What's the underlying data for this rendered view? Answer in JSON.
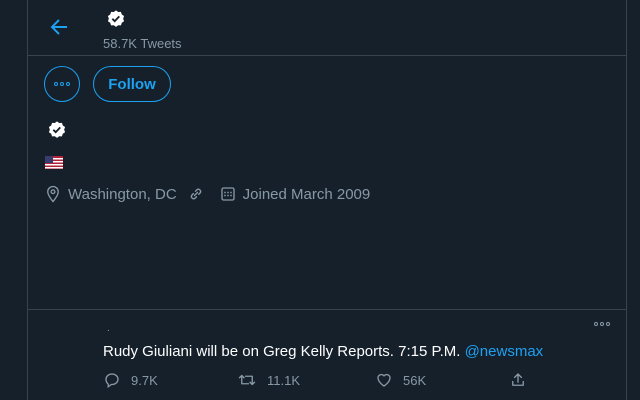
{
  "header": {
    "tweets_count": "58.7K Tweets"
  },
  "profile": {
    "follow_label": "Follow",
    "location": "Washington, DC",
    "joined": "Joined March 2009",
    "flag_emoji": "🇺🇸"
  },
  "tweet": {
    "dot": ".",
    "text": "Rudy Giuliani will be on Greg Kelly Reports. 7:15 P.M.",
    "mention": "@newsmax",
    "replies": "9.7K",
    "retweets": "11.1K",
    "likes": "56K"
  },
  "colors": {
    "background": "#15202b",
    "accent": "#1da1f2",
    "muted": "#8899a6",
    "divider": "#38444d"
  },
  "icons": {
    "back": "back-arrow-icon",
    "verified": "verified-badge-icon",
    "more": "more-icon",
    "location": "location-pin-icon",
    "link": "link-icon",
    "calendar": "calendar-icon",
    "reply": "reply-icon",
    "retweet": "retweet-icon",
    "like": "heart-icon",
    "share": "share-icon"
  }
}
